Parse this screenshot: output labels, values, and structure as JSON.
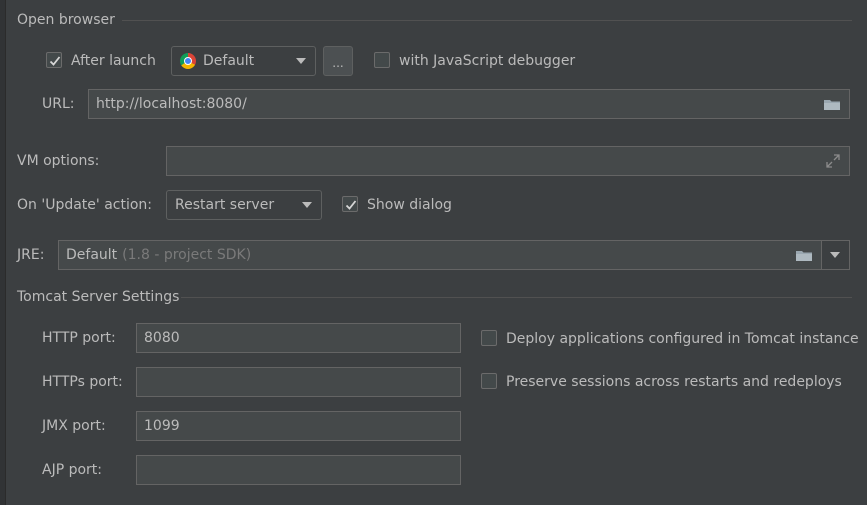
{
  "open_browser": {
    "section_title": "Open browser",
    "after_launch_label": "After launch",
    "after_launch_checked": true,
    "browser_value": "Default",
    "browser_icon": "chrome-icon",
    "ellipsis_label": "...",
    "js_debugger_label": "with JavaScript debugger",
    "js_debugger_checked": false,
    "url_label": "URL:",
    "url_value": "http://localhost:8080/"
  },
  "vm_options": {
    "label": "VM options:",
    "value": ""
  },
  "update_action": {
    "label": "On 'Update' action:",
    "value": "Restart server",
    "show_dialog_label": "Show dialog",
    "show_dialog_checked": true
  },
  "jre": {
    "label": "JRE:",
    "value": "Default",
    "hint": "(1.8 - project SDK)"
  },
  "tomcat": {
    "section_title": "Tomcat Server Settings",
    "http_port_label": "HTTP port:",
    "http_port_value": "8080",
    "https_port_label": "HTTPs port:",
    "https_port_value": "",
    "jmx_port_label": "JMX port:",
    "jmx_port_value": "1099",
    "ajp_port_label": "AJP port:",
    "ajp_port_value": "",
    "deploy_label": "Deploy applications configured in Tomcat instance",
    "deploy_checked": false,
    "preserve_label": "Preserve sessions across restarts and redeploys",
    "preserve_checked": false
  },
  "colors": {
    "background": "#3c3f41",
    "field_background": "#45494a",
    "text": "#bbbbbb"
  }
}
